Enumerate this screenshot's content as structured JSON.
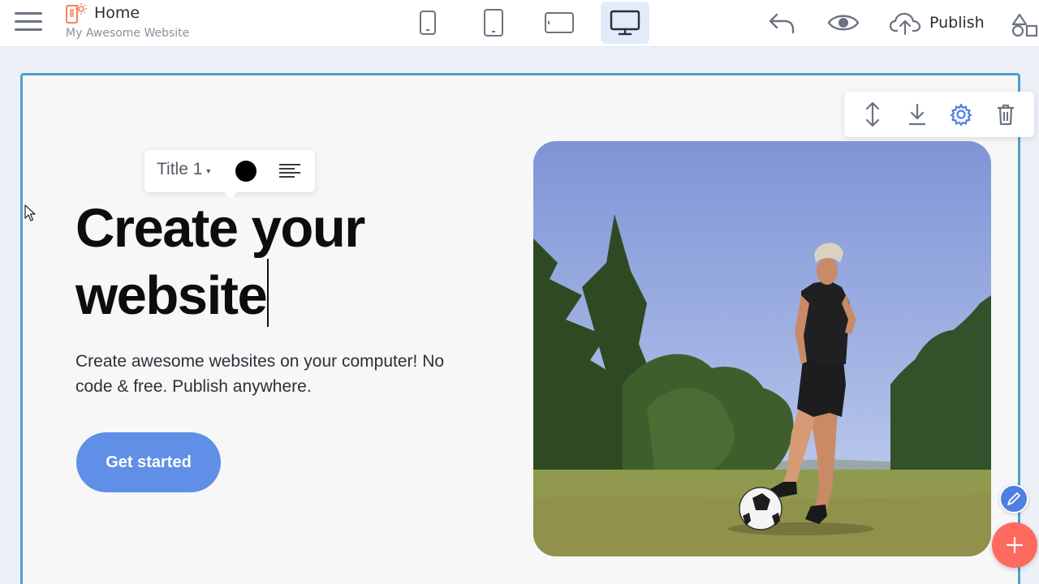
{
  "topbar": {
    "page_title": "Home",
    "site_name": "My Awesome Website",
    "publish_label": "Publish"
  },
  "devices": [
    "phone-small",
    "phone",
    "tablet",
    "desktop"
  ],
  "active_device": "desktop",
  "format_bar": {
    "style_label": "Title 1",
    "text_color": "#000000"
  },
  "hero": {
    "title_line1": "Create your",
    "title_line2": "website",
    "subtitle": "Create awesome websites on your computer! No code & free. Publish anywhere.",
    "cta_label": "Get started"
  },
  "colors": {
    "accent": "#5f8fe6",
    "canvas_border": "#4ba3c9",
    "add_fab": "#ff6a5f",
    "gear_active": "#4f7fe0"
  },
  "icons": {
    "topbar": [
      "menu-icon",
      "page-icon",
      "undo-icon",
      "eye-icon",
      "cloud-upload-icon",
      "blocks-icon"
    ],
    "block_tools": [
      "move-icon",
      "download-icon",
      "gear-icon",
      "trash-icon"
    ],
    "fabs": [
      "pencil-icon",
      "plus-icon"
    ]
  }
}
